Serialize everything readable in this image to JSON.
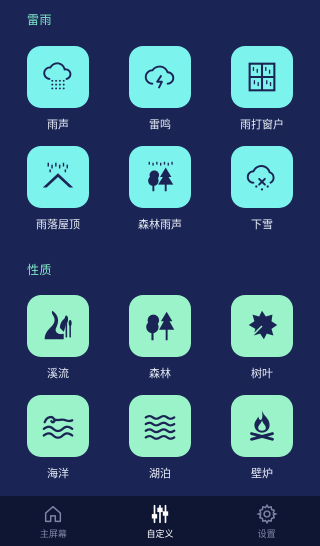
{
  "sections": [
    {
      "title": "雷雨",
      "tiles": [
        {
          "label": "雨声",
          "icon": "rain-cloud-icon"
        },
        {
          "label": "雷鸣",
          "icon": "thunder-cloud-icon"
        },
        {
          "label": "雨打窗户",
          "icon": "rain-window-icon"
        },
        {
          "label": "雨落屋顶",
          "icon": "rain-roof-icon"
        },
        {
          "label": "森林雨声",
          "icon": "forest-rain-icon"
        },
        {
          "label": "下雪",
          "icon": "snow-cloud-icon"
        }
      ]
    },
    {
      "title": "性质",
      "tiles": [
        {
          "label": "溪流",
          "icon": "stream-icon"
        },
        {
          "label": "森林",
          "icon": "forest-icon"
        },
        {
          "label": "树叶",
          "icon": "leaf-icon"
        },
        {
          "label": "海洋",
          "icon": "ocean-icon"
        },
        {
          "label": "湖泊",
          "icon": "lake-icon"
        },
        {
          "label": "壁炉",
          "icon": "fireplace-icon"
        }
      ]
    }
  ],
  "tabbar": {
    "home": "主屏幕",
    "custom": "自定义",
    "settings": "设置"
  },
  "colors": {
    "background": "#1b2555",
    "section_title": "#7fe8c8",
    "rain_tile": "#7df3ee",
    "nature_tile": "#9bf3c9",
    "icon_dark": "#1b2555",
    "tabbar_bg": "#0f1634",
    "tab_inactive": "#7d86a6",
    "tab_active": "#ffffff"
  }
}
